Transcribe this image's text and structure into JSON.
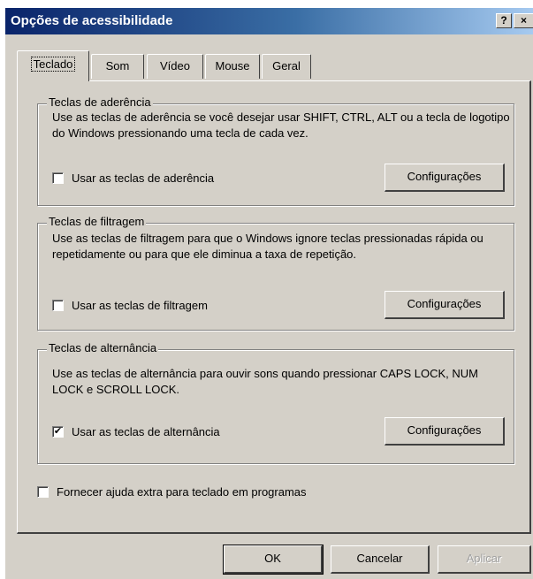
{
  "window": {
    "title": "Opções de acessibilidade",
    "help_label": "?",
    "close_label": "×"
  },
  "tabs": [
    {
      "label": "Teclado",
      "active": true
    },
    {
      "label": "Som",
      "active": false
    },
    {
      "label": "Vídeo",
      "active": false
    },
    {
      "label": "Mouse",
      "active": false
    },
    {
      "label": "Geral",
      "active": false
    }
  ],
  "groups": [
    {
      "title": "Teclas de aderência",
      "description": "Use as teclas de aderência se você desejar usar SHIFT, CTRL, ALT ou a tecla de logotipo do Windows pressionando uma tecla de cada vez.",
      "checkbox_label": "Usar as teclas de aderência",
      "checked": false,
      "button_label": "Configurações"
    },
    {
      "title": "Teclas de filtragem",
      "description": "Use as teclas de filtragem para que o Windows ignore teclas pressionadas rápida ou repetidamente ou para que ele diminua a taxa de repetição.",
      "checkbox_label": "Usar as teclas de filtragem",
      "checked": false,
      "button_label": "Configurações"
    },
    {
      "title": "Teclas de alternância",
      "description": "Use as teclas de alternância para ouvir sons quando pressionar CAPS LOCK, NUM LOCK e SCROLL LOCK.",
      "checkbox_label": "Usar as teclas de alternância",
      "checked": true,
      "button_label": "Configurações"
    }
  ],
  "extra_help": {
    "label": "Fornecer ajuda extra para teclado em programas",
    "checked": false
  },
  "footer": {
    "ok_label": "OK",
    "cancel_label": "Cancelar",
    "apply_label": "Aplicar"
  },
  "check_glyph": "✔"
}
